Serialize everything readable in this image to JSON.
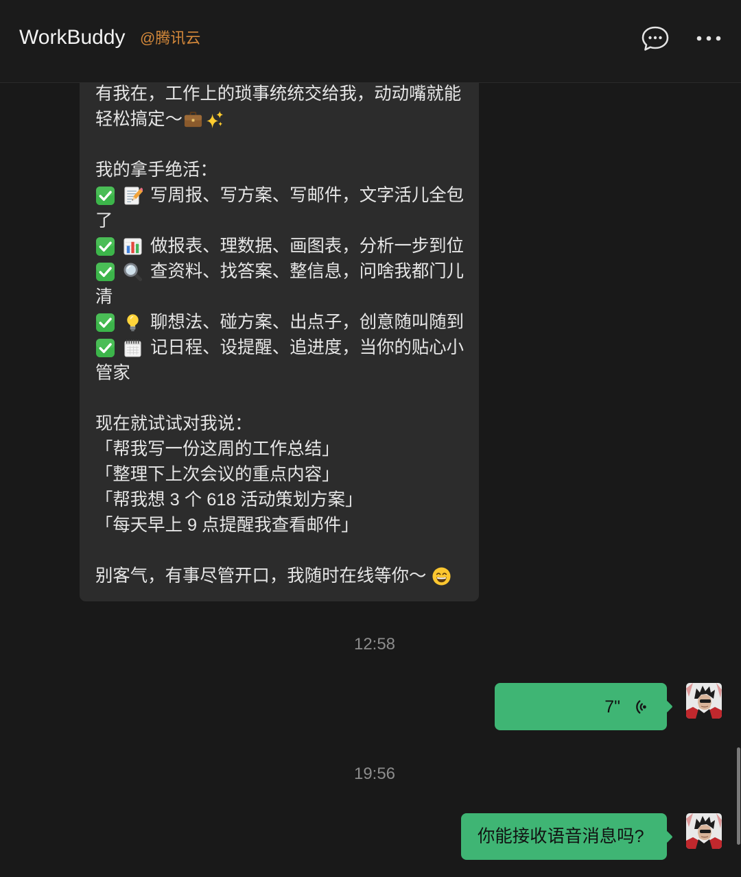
{
  "header": {
    "title": "WorkBuddy",
    "account_tag": "@腾讯云",
    "chat_icon": "chat-bubble-icon",
    "more_icon": "more-dots-icon"
  },
  "colors": {
    "page_background": "#191919",
    "header_background": "#1b1b1b",
    "received_bubble": "#2c2c2c",
    "sent_bubble": "#3fb574",
    "account_tag": "#d4883a",
    "timestamp": "#8c8c8c"
  },
  "chat": {
    "received_message": {
      "lines": [
        {
          "text": "有我在，工作上的琐事统统交给我，动动嘴就能"
        },
        {
          "text": "轻松搞定～",
          "icons_after": [
            "briefcase-icon",
            "sparkles-icon"
          ]
        },
        {
          "text": ""
        },
        {
          "text": "我的拿手绝活："
        },
        {
          "icons_before": [
            "check-box-icon",
            "memo-icon"
          ],
          "text": "写周报、写方案、写邮件，文字活儿全包"
        },
        {
          "text": "了"
        },
        {
          "icons_before": [
            "check-box-icon",
            "bar-chart-icon"
          ],
          "text": "做报表、理数据、画图表，分析一步到位"
        },
        {
          "icons_before": [
            "check-box-icon",
            "magnifier-icon"
          ],
          "text": "查资料、找答案、整信息，问啥我都门儿"
        },
        {
          "text": "清"
        },
        {
          "icons_before": [
            "check-box-icon",
            "light-bulb-icon"
          ],
          "text": "聊想法、碰方案、出点子，创意随叫随到"
        },
        {
          "icons_before": [
            "check-box-icon",
            "calendar-icon"
          ],
          "text": "记日程、设提醒、追进度，当你的贴心小"
        },
        {
          "text": "管家"
        },
        {
          "text": ""
        },
        {
          "text": "现在就试试对我说："
        },
        {
          "text": "「帮我写一份这周的工作总结」"
        },
        {
          "text": "「整理下上次会议的重点内容」"
        },
        {
          "text": "「帮我想 3 个 618 活动策划方案」"
        },
        {
          "text": "「每天早上 9 点提醒我查看邮件」"
        },
        {
          "text": ""
        },
        {
          "text": "别客气，有事尽管开口，我随时在线等你～",
          "icons_after": [
            "grinning-face-icon"
          ]
        }
      ]
    },
    "timestamps": [
      "12:58",
      "19:56"
    ],
    "voice_message": {
      "duration": "7\"",
      "icon": "voice-wave-icon",
      "avatar": "user-avatar"
    },
    "text_message": {
      "text": "你能接收语音消息吗?",
      "avatar": "user-avatar"
    }
  }
}
